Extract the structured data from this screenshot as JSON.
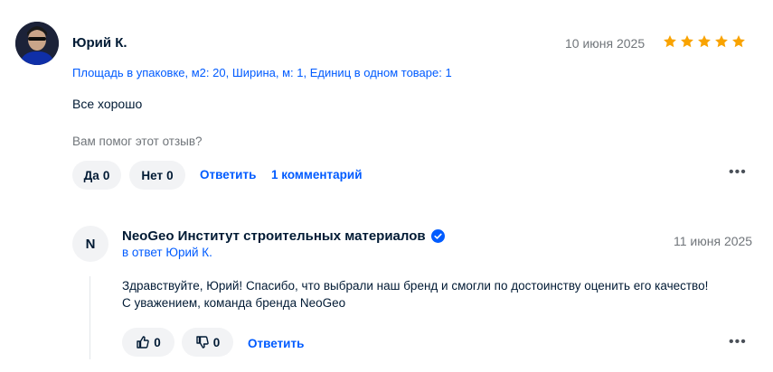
{
  "review": {
    "author": "Юрий К.",
    "date": "10 июня 2025",
    "rating": 5,
    "star_color": "#f9a300",
    "params": "Площадь в упаковке, м2: 20, Ширина, м: 1, Единиц в одном товаре: 1",
    "text": "Все хорошо",
    "helpful_question": "Вам помог этот отзыв?",
    "yes_label": "Да",
    "yes_count": "0",
    "no_label": "Нет",
    "no_count": "0",
    "reply_label": "Ответить",
    "comments_label": "1 комментарий",
    "more_label": "•••"
  },
  "reply": {
    "avatar_letter": "N",
    "author": "NeoGeo Институт строительных материалов",
    "in_reply_to": "в ответ Юрий К.",
    "date": "11 июня 2025",
    "text": "Здравствуйте, Юрий! Спасибо, что выбрали наш бренд и смогли по достоинству оценить его качество! С уважением, команда бренда NeoGeo",
    "like_count": "0",
    "dislike_count": "0",
    "reply_label": "Ответить",
    "more_label": "•••"
  },
  "colors": {
    "accent": "#005bff",
    "muted": "#70757a",
    "text": "#001a34",
    "pill_bg": "#f2f3f5"
  }
}
